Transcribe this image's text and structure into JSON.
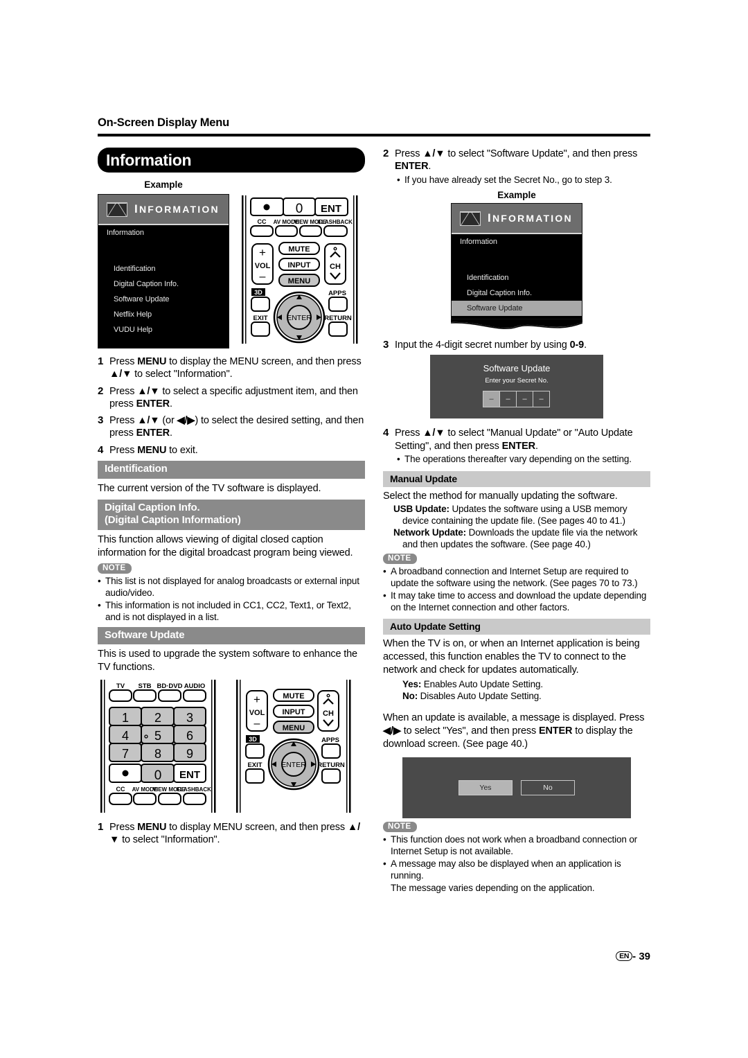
{
  "header": {
    "title": "On-Screen Display Menu"
  },
  "section_title": "Information",
  "left": {
    "example_caption": "Example",
    "osd": {
      "bar_title_first": "I",
      "bar_title_rest": "NFORMATION",
      "items": [
        "Information",
        "Identification",
        "Digital Caption Info.",
        "Software Update",
        "Netflix Help",
        "VUDU Help"
      ]
    },
    "steps": [
      {
        "num": "1",
        "pre": "Press ",
        "b1": "MENU",
        "mid": " to display the MENU screen, and then press ",
        "b2": "▲/▼",
        "post": " to select \"Information\"."
      },
      {
        "num": "2",
        "pre": "Press ",
        "b1": "▲/▼",
        "mid": " to select a specific adjustment item, and then press ",
        "b2": "ENTER",
        "post": "."
      },
      {
        "num": "3",
        "pre": "Press ",
        "b1": "▲/▼",
        "mid": " (or ",
        "b2": "◀/▶",
        "post": ") to select the desired setting, and then press ENTER."
      },
      {
        "num": "4",
        "pre": "Press ",
        "b1": "MENU",
        "mid": " to exit.",
        "b2": "",
        "post": ""
      }
    ],
    "identification": {
      "heading": "Identification",
      "body": "The current version of the TV software is displayed."
    },
    "digital_caption": {
      "heading_line1": "Digital Caption Info.",
      "heading_line2": "(Digital Caption Information)",
      "body": "This function allows viewing of digital closed caption information for the digital broadcast program being viewed.",
      "note_label": "NOTE",
      "notes": [
        "This list is not displayed for analog broadcasts or external input audio/video.",
        "This information is not included in CC1, CC2, Text1, or Text2, and is not displayed in a list."
      ]
    },
    "software_update": {
      "heading": "Software Update",
      "body": "This is used to upgrade the system software to enhance the TV functions.",
      "step1_num": "1",
      "step1_pre": "Press ",
      "step1_b1": "MENU",
      "step1_mid": " to display MENU screen, and then press ",
      "step1_b2": "▲/▼",
      "step1_post": " to select \"Information\"."
    }
  },
  "right": {
    "step2": {
      "num": "2",
      "pre": "Press ",
      "b1": "▲/▼",
      "mid": " to select \"Software Update\", and then press ",
      "b2": "ENTER",
      "post": ".",
      "bullet": "If you have already set the Secret No., go to step 3."
    },
    "example_caption": "Example",
    "osd": {
      "bar_title_first": "I",
      "bar_title_rest": "NFORMATION",
      "items": [
        "Information",
        "Identification",
        "Digital Caption Info.",
        "Software Update"
      ],
      "selected": "Software Update"
    },
    "step3": {
      "num": "3",
      "pre": "Input the 4-digit secret number by using ",
      "b1": "0-9",
      "post": "."
    },
    "secret_dialog": {
      "title": "Software Update",
      "subtitle": "Enter your Secret No.",
      "digits": [
        "–",
        "–",
        "–",
        "–"
      ]
    },
    "step4": {
      "num": "4",
      "pre": "Press ",
      "b1": "▲/▼",
      "mid": " to select \"Manual Update\" or \"Auto Update Setting\", and then press ",
      "b2": "ENTER",
      "post": ".",
      "bullet": "The operations thereafter vary depending on the setting."
    },
    "manual_update": {
      "heading": "Manual Update",
      "body": "Select the method for manually updating the software.",
      "def1_label": "USB Update:",
      "def1_text": " Updates the software using a USB memory device containing the update file. (See pages 40 to 41.)",
      "def2_label": "Network Update:",
      "def2_text": " Downloads the update file via the network and then updates the software. (See page 40.)",
      "note_label": "NOTE",
      "notes": [
        "A broadband connection and Internet Setup are required to update the software using the network. (See pages 70 to 73.)",
        "It may take time to access and download the update depending on the Internet connection and other factors."
      ]
    },
    "auto_update": {
      "heading": "Auto Update Setting",
      "body": "When the TV is on, or when an Internet application is being accessed, this function enables the TV to connect to the network and check for updates automatically.",
      "def1_label": "Yes:",
      "def1_text": " Enables Auto Update Setting.",
      "def2_label": "No:",
      "def2_text": " Disables Auto Update Setting.",
      "body2_pre": "When an update is available, a message is displayed. Press ",
      "body2_b1": "◀/▶",
      "body2_mid": " to select \"Yes\", and then press ",
      "body2_b2": "ENTER",
      "body2_post": " to display the download screen. (See page 40.)",
      "yes_label": "Yes",
      "no_label": "No",
      "note_label": "NOTE",
      "notes": [
        "This function does not work when a broadband connection or Internet Setup is not available.",
        "A message may also be displayed when an application is running.",
        "The message varies depending on the application."
      ]
    }
  },
  "remote": {
    "top_row": [
      "TV",
      "STB",
      "BD·DVD",
      "AUDIO"
    ],
    "keypad": [
      "1",
      "2",
      "3",
      "4",
      "5",
      "6",
      "7",
      "8",
      "9"
    ],
    "bottom_keys": [
      "●",
      "0",
      "ENT"
    ],
    "func_row": [
      "CC",
      "AV MODE",
      "VIEW MODE",
      "FLASHBACK"
    ],
    "vol_plus": "+",
    "vol_label": "VOL",
    "vol_minus": "–",
    "mute": "MUTE",
    "input": "INPUT",
    "menu": "MENU",
    "ch_label": "CH",
    "three_d": "3D",
    "apps": "APPS",
    "exit": "EXIT",
    "return": "RETURN",
    "enter": "ENTER"
  },
  "footer": {
    "lang": "EN",
    "dash": "-",
    "page": "39"
  }
}
